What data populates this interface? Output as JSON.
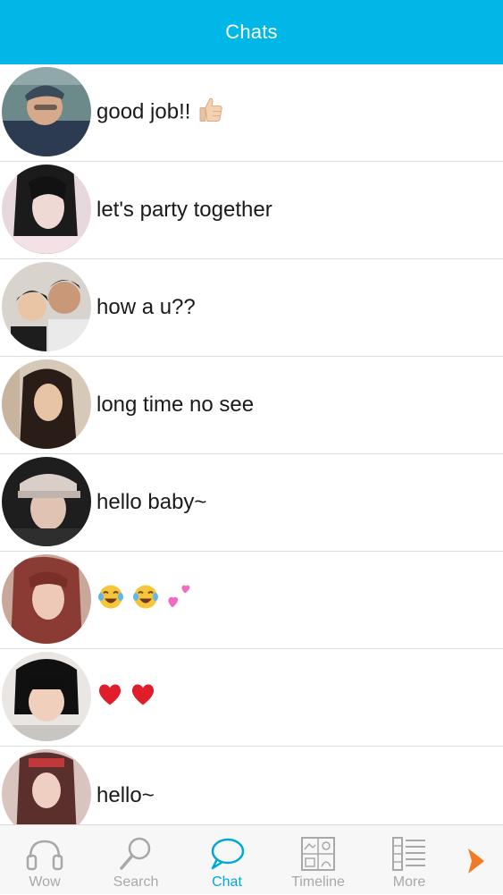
{
  "header": {
    "title": "Chats",
    "background": "#00b7e8"
  },
  "chats": [
    {
      "message": "good job!!",
      "emoji": [
        "thumbs-up"
      ]
    },
    {
      "message": "let's party together",
      "emoji": []
    },
    {
      "message": "how a u??",
      "emoji": []
    },
    {
      "message": "long time no see",
      "emoji": []
    },
    {
      "message": "hello baby~",
      "emoji": []
    },
    {
      "message": "",
      "emoji": [
        "tears-of-joy",
        "tears-of-joy",
        "two-hearts"
      ]
    },
    {
      "message": "",
      "emoji": [
        "red-heart",
        "red-heart"
      ]
    },
    {
      "message": "hello~",
      "emoji": []
    }
  ],
  "tabbar": {
    "tabs": [
      {
        "label": "Wow",
        "icon": "headphones-icon"
      },
      {
        "label": "Search",
        "icon": "magnifier-icon"
      },
      {
        "label": "Chat",
        "icon": "speech-bubble-icon",
        "active": true
      },
      {
        "label": "Timeline",
        "icon": "timeline-grid-icon"
      },
      {
        "label": "More",
        "icon": "list-icon"
      }
    ],
    "next_icon": "chevron-right-icon",
    "active_color": "#00a8d8",
    "inactive_color": "#a8a8a8",
    "arrow_color": "#f07a25"
  }
}
